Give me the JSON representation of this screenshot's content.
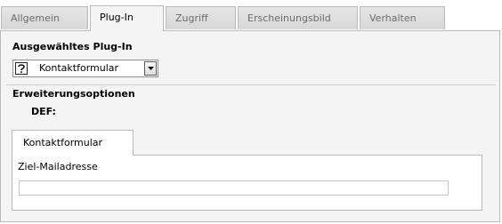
{
  "tabs": [
    {
      "label": "Allgemein",
      "active": false
    },
    {
      "label": "Plug-In",
      "active": true
    },
    {
      "label": "Zugriff",
      "active": false
    },
    {
      "label": "Erscheinungsbild",
      "active": false
    },
    {
      "label": "Verhalten",
      "active": false
    }
  ],
  "plugin_section": {
    "title": "Ausgewähltes Plug-In",
    "select_value": "Kontaktformular",
    "select_icon": "help-question-icon"
  },
  "extension_section": {
    "title": "Erweiterungsoptionen",
    "def_label": "DEF:"
  },
  "subtabs": [
    {
      "label": "Kontaktformular",
      "active": true
    }
  ],
  "form": {
    "field_label": "Ziel-Mailadresse",
    "field_value": "",
    "field_placeholder": ""
  }
}
